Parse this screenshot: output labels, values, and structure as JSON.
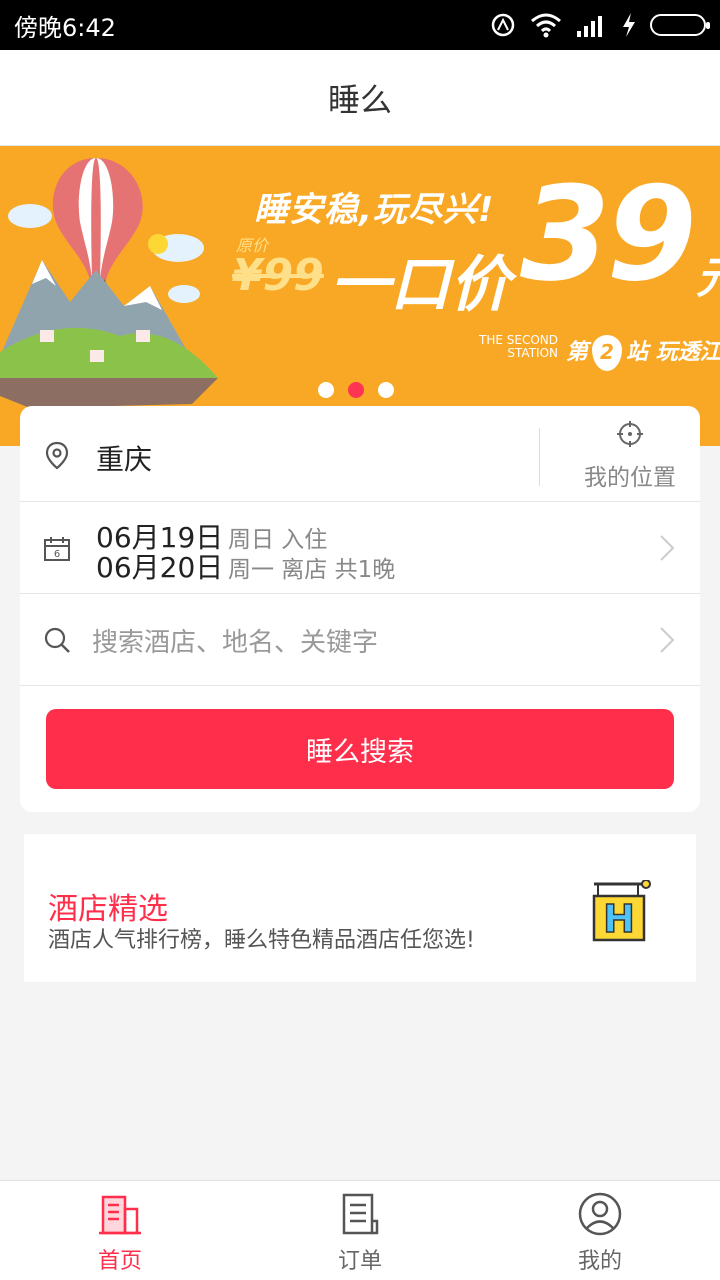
{
  "status_bar": {
    "time": "傍晚6:42"
  },
  "header": {
    "title": "睡么"
  },
  "banner": {
    "headline": "睡安稳,玩尽兴!",
    "original_label": "原价",
    "original_price": "¥99",
    "deal_text": "一口价",
    "price": "39",
    "price_unit": "元",
    "station_en": "THE SECOND STATION",
    "station_prefix": "第",
    "station_number": "2",
    "station_suffix": "站 玩透江",
    "page_count": 3,
    "active_page": 2
  },
  "search": {
    "city": "重庆",
    "my_location_label": "我的位置",
    "checkin_date": "06月19日",
    "checkin_note": "周日 入住",
    "checkout_date": "06月20日",
    "checkout_note": "周一 离店 共1晚",
    "keyword_placeholder": "搜索酒店、地名、关键字",
    "search_button": "睡么搜索"
  },
  "featured": {
    "title": "酒店精选",
    "subtitle": "酒店人气排行榜，睡么特色精品酒店任您选!"
  },
  "tabbar": {
    "items": [
      {
        "label": "首页",
        "icon": "building-icon",
        "active": true
      },
      {
        "label": "订单",
        "icon": "document-icon",
        "active": false
      },
      {
        "label": "我的",
        "icon": "user-icon",
        "active": false
      }
    ]
  },
  "colors": {
    "accent": "#ff2f4c",
    "banner_bg": "#f9a825"
  }
}
